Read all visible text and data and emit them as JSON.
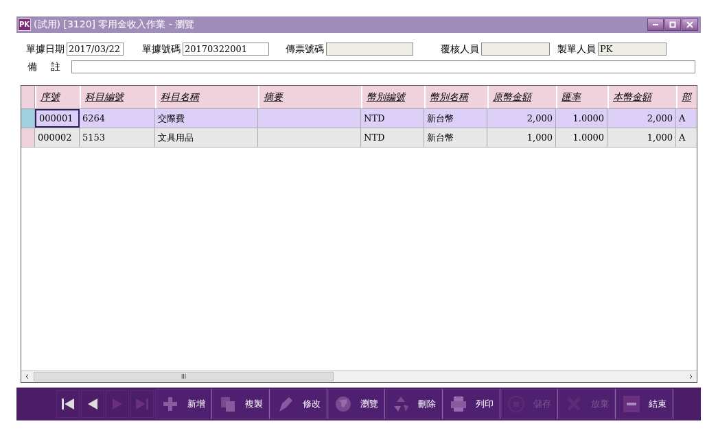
{
  "window": {
    "title": "(試用) [3120] 零用金收入作業 - 瀏覽",
    "logo": "PK"
  },
  "form": {
    "row1": [
      {
        "label": "單據日期",
        "value": "2017/03/22",
        "kind": "edit"
      },
      {
        "label": "單據號碼",
        "value": "20170322001",
        "kind": "edit"
      },
      {
        "label": "傳票號碼",
        "kind": "readonly"
      },
      {
        "label": "覆核人員",
        "kind": "readonly"
      },
      {
        "label": "製單人員",
        "value": "PK",
        "kind": "readonly"
      }
    ],
    "note": {
      "label_1": "備",
      "label_2": "註"
    }
  },
  "table": {
    "columns": [
      "序號",
      "科目編號",
      "科目名稱",
      "摘要",
      "幣別編號",
      "幣別名稱",
      "原幣金額",
      "匯率",
      "本幣金額",
      "部"
    ],
    "rows": [
      {
        "selected": true,
        "cells": [
          "000001",
          "6264",
          "交際費",
          "",
          "NTD",
          "新台幣",
          "2,000",
          "1.0000",
          "2,000",
          "A"
        ]
      },
      {
        "selected": false,
        "cells": [
          "000002",
          "5153",
          "文具用品",
          "",
          "NTD",
          "新台幣",
          "1,000",
          "1.0000",
          "1,000",
          "A"
        ]
      }
    ],
    "scroll_grip": "III"
  },
  "toolbar": [
    {
      "kind": "first",
      "disabled": false
    },
    {
      "kind": "prev",
      "disabled": false
    },
    {
      "kind": "next",
      "disabled": true
    },
    {
      "kind": "last",
      "disabled": true
    },
    {
      "kind": "add",
      "label": "新增",
      "disabled": false
    },
    {
      "kind": "copy",
      "label": "複製",
      "disabled": false
    },
    {
      "kind": "edit",
      "label": "修改",
      "disabled": false
    },
    {
      "kind": "browse",
      "label": "瀏覽",
      "disabled": false
    },
    {
      "kind": "delete",
      "label": "刪除",
      "disabled": false
    },
    {
      "kind": "print",
      "label": "列印",
      "disabled": false
    },
    {
      "kind": "save",
      "label": "儲存",
      "disabled": true
    },
    {
      "kind": "discard",
      "label": "放棄",
      "disabled": true
    },
    {
      "kind": "exit",
      "label": "結束",
      "disabled": false
    }
  ]
}
